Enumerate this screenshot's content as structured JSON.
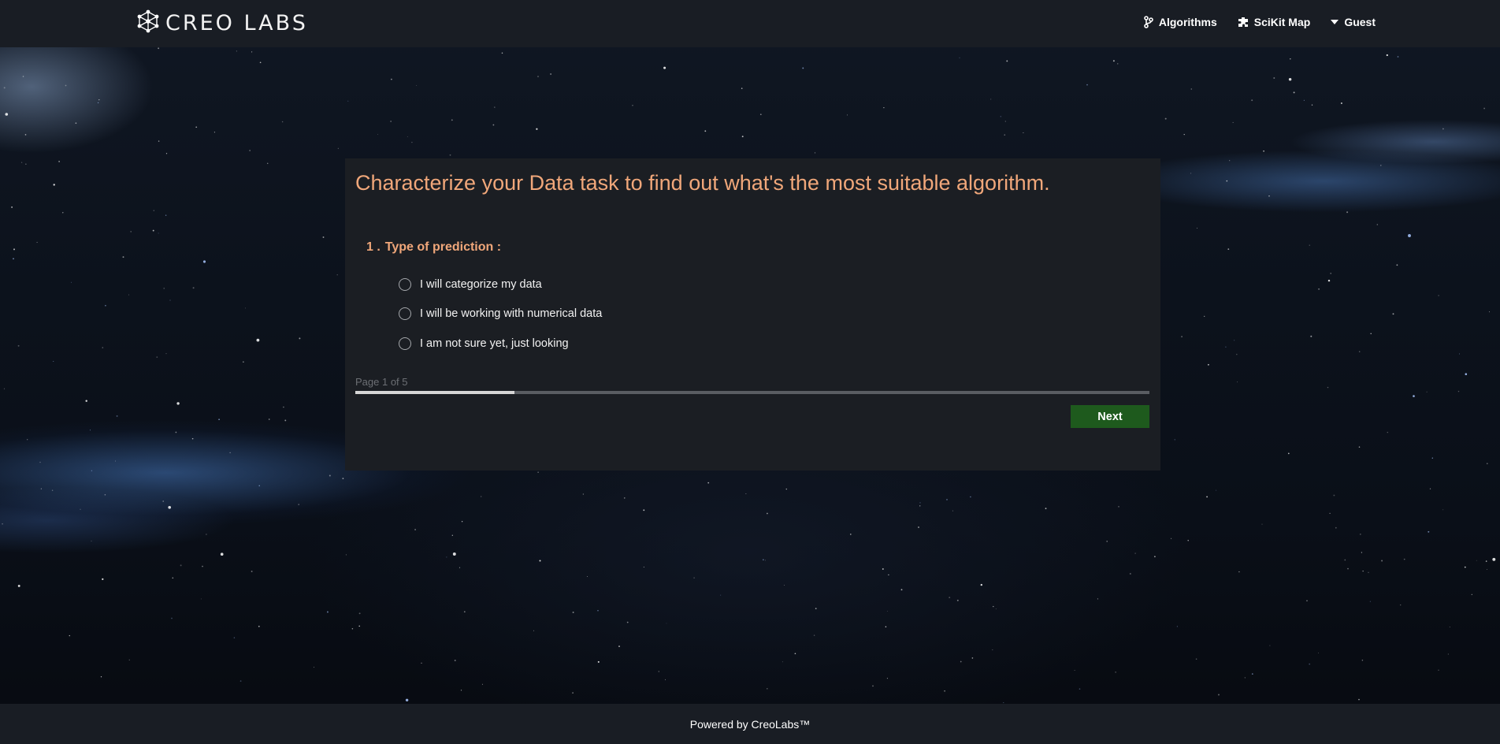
{
  "navbar": {
    "brand_text": "CREO LABS",
    "items": [
      {
        "label": "Algorithms",
        "icon": "git-branch-icon"
      },
      {
        "label": "SciKit Map",
        "icon": "puzzle-icon"
      },
      {
        "label": "Guest",
        "icon": "caret-down-icon"
      }
    ]
  },
  "card": {
    "title": "Characterize your Data task to find out what's the most suitable algorithm.",
    "question": {
      "number": "1 .",
      "text": "Type of prediction :",
      "options": [
        "I will categorize my data",
        "I will be working with numerical data",
        "I am not sure yet, just looking"
      ]
    },
    "progress": {
      "label": "Page 1 of 5",
      "fraction": 0.2
    },
    "next_label": "Next"
  },
  "footer": {
    "text": "Powered by CreoLabs™"
  },
  "colors": {
    "accent": "#f0a77a",
    "navbar_bg": "#191d24",
    "card_bg": "#1b1e23",
    "next_button": "#1e5a1d"
  }
}
